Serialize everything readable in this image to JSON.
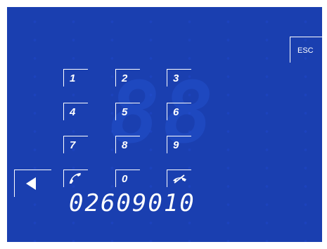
{
  "keypad": {
    "keys": [
      {
        "id": "1",
        "label": "1"
      },
      {
        "id": "2",
        "label": "2"
      },
      {
        "id": "3",
        "label": "3"
      },
      {
        "id": "4",
        "label": "4"
      },
      {
        "id": "5",
        "label": "5"
      },
      {
        "id": "6",
        "label": "6"
      },
      {
        "id": "7",
        "label": "7"
      },
      {
        "id": "8",
        "label": "8"
      },
      {
        "id": "9",
        "label": "9"
      },
      {
        "id": "call",
        "icon": "phone-call-icon"
      },
      {
        "id": "0",
        "label": "0"
      },
      {
        "id": "hangup",
        "icon": "phone-hangup-icon"
      }
    ]
  },
  "esc_label": "ESC",
  "back_icon": "arrow-left-icon",
  "display": {
    "number": "02609010"
  },
  "colors": {
    "background": "#1a3fb0",
    "foreground": "#ffffff"
  }
}
